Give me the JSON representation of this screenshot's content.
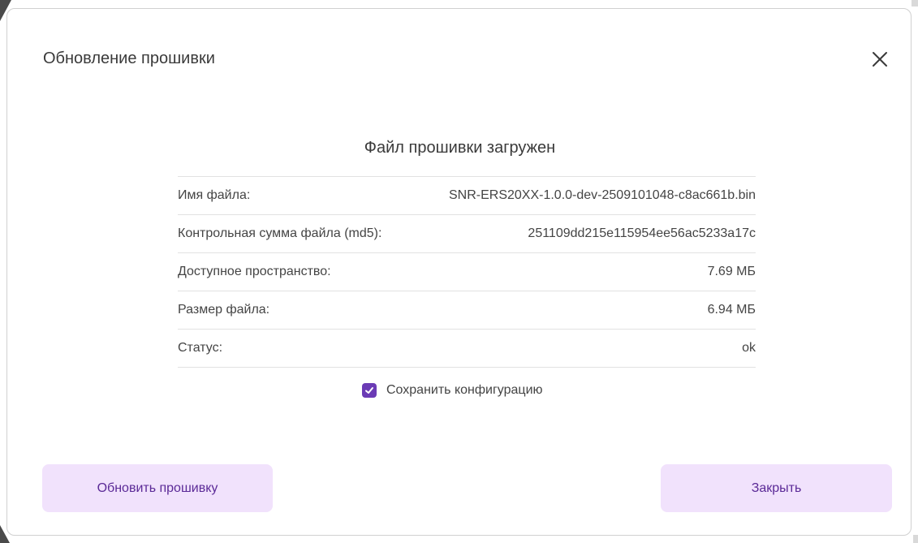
{
  "dialog": {
    "title": "Обновление прошивки",
    "close_icon": "close-icon"
  },
  "section": {
    "title": "Файл прошивки загружен"
  },
  "info_rows": [
    {
      "label": "Имя файла:",
      "value": "SNR-ERS20XX-1.0.0-dev-2509101048-c8ac661b.bin"
    },
    {
      "label": "Контрольная сумма файла (md5):",
      "value": "251109dd215e115954ee56ac5233a17c"
    },
    {
      "label": "Доступное пространство:",
      "value": "7.69 МБ"
    },
    {
      "label": "Размер файла:",
      "value": "6.94 МБ"
    },
    {
      "label": "Статус:",
      "value": "ok"
    }
  ],
  "save_config": {
    "label": "Сохранить конфигурацию",
    "checked": true
  },
  "buttons": {
    "update_label": "Обновить прошивку",
    "close_label": "Закрыть"
  },
  "colors": {
    "accent": "#6b3bb5",
    "button_bg": "#f1e2fc",
    "button_text": "#5b2a97"
  }
}
